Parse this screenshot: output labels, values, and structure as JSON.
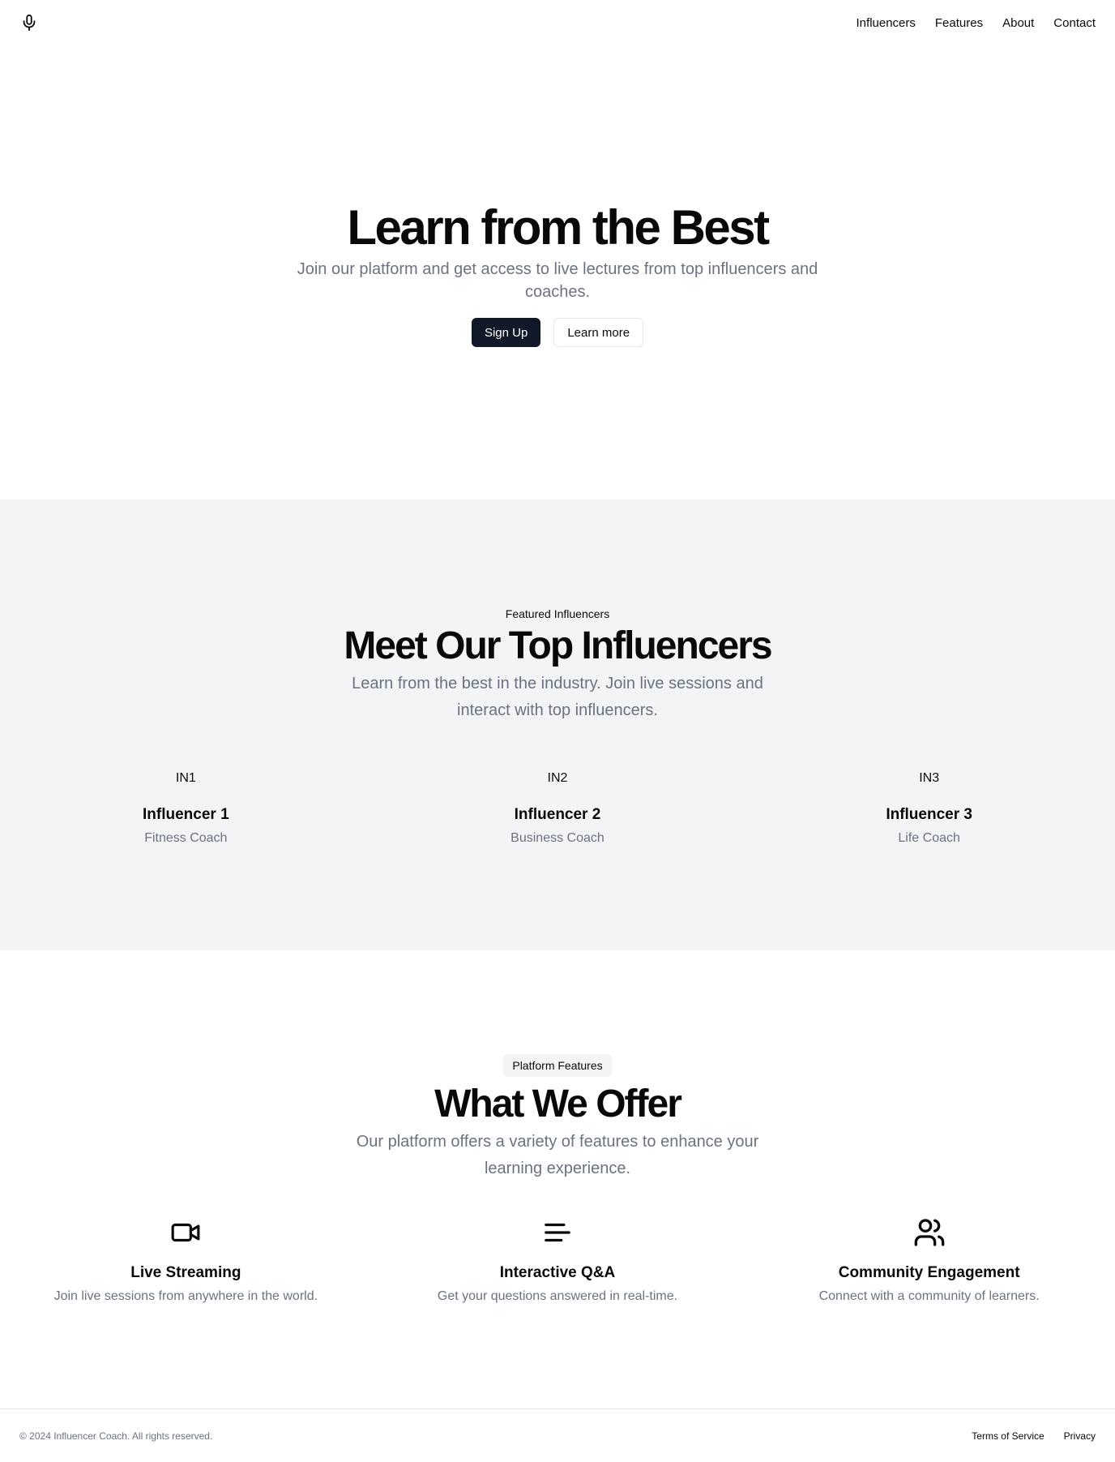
{
  "header": {
    "logo_icon": "microphone-icon",
    "nav": [
      {
        "label": "Influencers"
      },
      {
        "label": "Features"
      },
      {
        "label": "About"
      },
      {
        "label": "Contact"
      }
    ]
  },
  "hero": {
    "title": "Learn from the Best",
    "subtitle": "Join our platform and get access to live lectures from top influencers and coaches.",
    "primary_button": "Sign Up",
    "secondary_button": "Learn more"
  },
  "influencers": {
    "eyebrow": "Featured Influencers",
    "title": "Meet Our Top Influencers",
    "description": "Learn from the best in the industry. Join live sessions and interact with top influencers.",
    "items": [
      {
        "avatar": "IN1",
        "name": "Influencer 1",
        "role": "Fitness Coach"
      },
      {
        "avatar": "IN2",
        "name": "Influencer 2",
        "role": "Business Coach"
      },
      {
        "avatar": "IN3",
        "name": "Influencer 3",
        "role": "Life Coach"
      }
    ]
  },
  "features": {
    "badge": "Platform Features",
    "title": "What We Offer",
    "description": "Our platform offers a variety of features to enhance your learning experience.",
    "items": [
      {
        "icon": "video-camera-icon",
        "title": "Live Streaming",
        "description": "Join live sessions from anywhere in the world."
      },
      {
        "icon": "text-lines-icon",
        "title": "Interactive Q&A",
        "description": "Get your questions answered in real-time."
      },
      {
        "icon": "users-icon",
        "title": "Community Engagement",
        "description": "Connect with a community of learners."
      }
    ]
  },
  "footer": {
    "copyright": "© 2024 Influencer Coach. All rights reserved.",
    "links": [
      {
        "label": "Terms of Service"
      },
      {
        "label": "Privacy"
      }
    ]
  },
  "colors": {
    "primary_button_bg": "#111827",
    "muted_text": "#6b7280",
    "section_bg": "#f3f4f6"
  }
}
